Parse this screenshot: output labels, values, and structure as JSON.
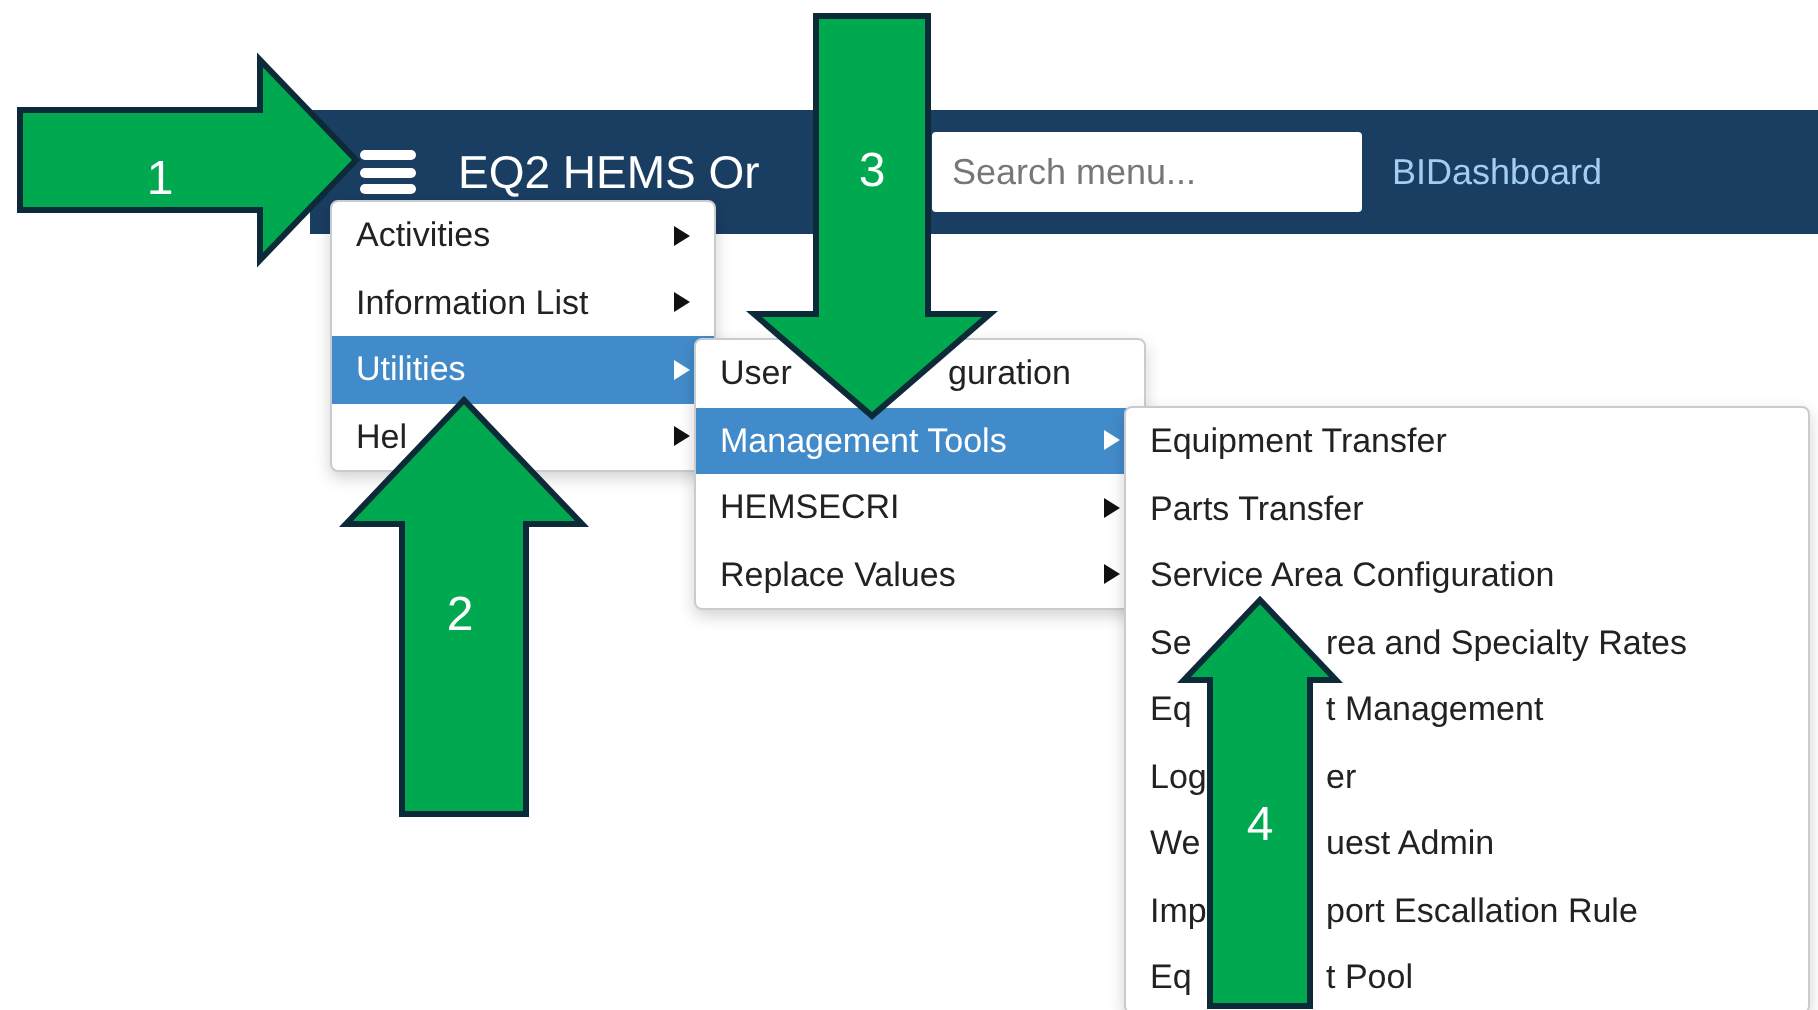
{
  "navbar": {
    "title": "EQ2 HEMS Or",
    "search": {
      "placeholder": "Search menu..."
    },
    "links": [
      "BIDashboard"
    ]
  },
  "menus": [
    {
      "items": [
        {
          "parts": [
            "Activities"
          ],
          "submenu": true,
          "selected": false
        },
        {
          "parts": [
            "Information List"
          ],
          "submenu": true,
          "selected": false
        },
        {
          "parts": [
            "Utilities"
          ],
          "submenu": true,
          "selected": true
        },
        {
          "parts": [
            "Hel"
          ],
          "submenu": true,
          "selected": false
        }
      ]
    },
    {
      "items": [
        {
          "parts": [
            "User",
            "guration"
          ],
          "submenu": false,
          "selected": false
        },
        {
          "parts": [
            "Management Tools"
          ],
          "submenu": true,
          "selected": true
        },
        {
          "parts": [
            "HEMSECRI"
          ],
          "submenu": true,
          "selected": false
        },
        {
          "parts": [
            "Replace Values"
          ],
          "submenu": true,
          "selected": false
        }
      ]
    },
    {
      "items": [
        {
          "parts": [
            "Equipment Transfer"
          ],
          "submenu": false,
          "selected": false
        },
        {
          "parts": [
            "Parts Transfer"
          ],
          "submenu": false,
          "selected": false
        },
        {
          "parts": [
            "Service Area Configuration"
          ],
          "submenu": false,
          "selected": false
        },
        {
          "parts": [
            "Se",
            "rea and Specialty Rates"
          ],
          "submenu": false,
          "selected": false
        },
        {
          "parts": [
            "Eq",
            "t Management"
          ],
          "submenu": false,
          "selected": false
        },
        {
          "parts": [
            "Log",
            "er"
          ],
          "submenu": false,
          "selected": false
        },
        {
          "parts": [
            "We",
            "uest Admin"
          ],
          "submenu": false,
          "selected": false
        },
        {
          "parts": [
            "Imp",
            "port Escallation Rule"
          ],
          "submenu": false,
          "selected": false
        },
        {
          "parts": [
            "Eq",
            "t Pool"
          ],
          "submenu": false,
          "selected": false
        }
      ]
    }
  ],
  "annotations": [
    {
      "number": "1",
      "kind": "right"
    },
    {
      "number": "2",
      "kind": "up"
    },
    {
      "number": "3",
      "kind": "down"
    },
    {
      "number": "4",
      "kind": "up"
    }
  ]
}
